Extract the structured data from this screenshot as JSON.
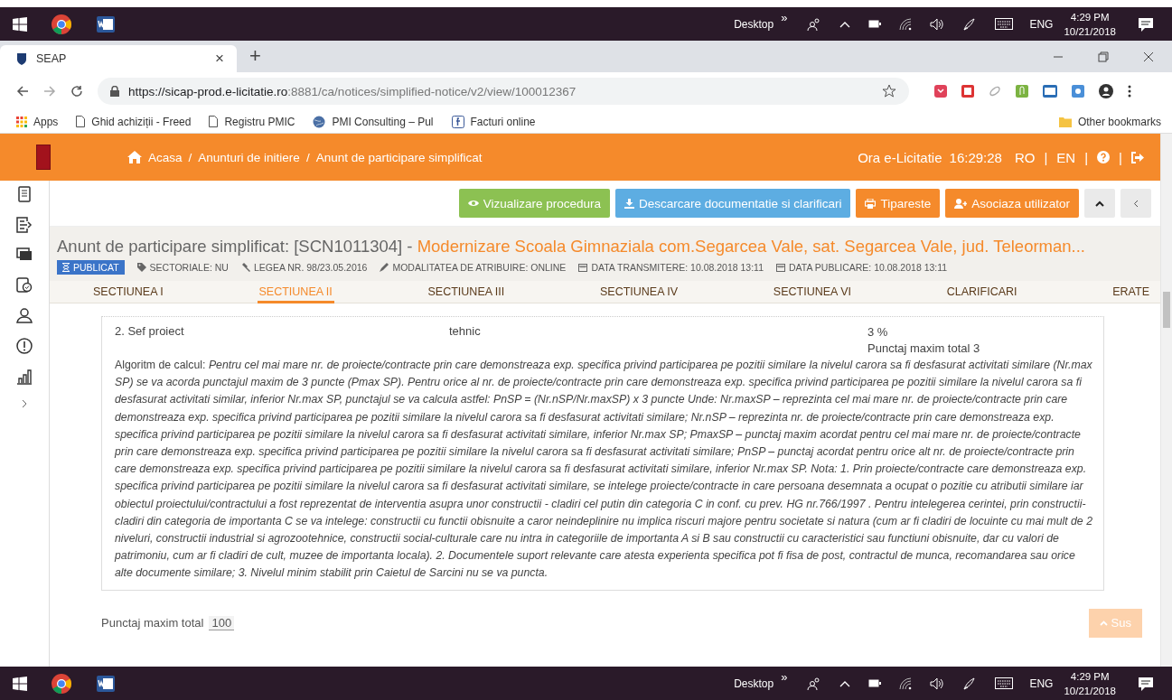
{
  "taskbars": [
    {
      "desktop_label": "Desktop",
      "overflow": "»",
      "language": "ENG",
      "time": "4:29 PM",
      "date": "10/21/2018"
    },
    {
      "desktop_label": "Desktop",
      "overflow": "»",
      "language": "ENG",
      "time": "4:29 PM",
      "date": "10/21/2018"
    }
  ],
  "browser": {
    "tab": {
      "title": "SEAP",
      "close": "×"
    },
    "new_tab": "+",
    "url_host": "https://sicap-prod.e-licitatie.ro",
    "url_path": ":8881/ca/notices/simplified-notice/v2/view/100012367",
    "bookmarks": [
      {
        "label": "Apps",
        "kind": "apps"
      },
      {
        "label": "Ghid achiziții - Freed",
        "kind": "page"
      },
      {
        "label": "Registru PMIC",
        "kind": "page"
      },
      {
        "label": "PMI Consulting – Pul",
        "kind": "globe"
      },
      {
        "label": "Facturi online",
        "kind": "f"
      }
    ],
    "other_bookmarks": "Other bookmarks"
  },
  "header": {
    "breadcrumbs": [
      "Acasa",
      "Anunturi de initiere",
      "Anunt de participare simplificat"
    ],
    "breadcrumb_separator": "/",
    "clock_label": "Ora e-Licitatie",
    "clock": "16:29:28",
    "languages": [
      "RO",
      "EN"
    ],
    "separator": "|"
  },
  "toolbar": [
    {
      "label": "Vizualizare procedura",
      "kind": "view"
    },
    {
      "label": "Descarcare documentatie si clarificari",
      "kind": "download"
    },
    {
      "label": "Tipareste",
      "kind": "print"
    },
    {
      "label": "Asociaza utilizator",
      "kind": "user"
    }
  ],
  "notice": {
    "title_prefix": "Anunt de participare simplificat: [SCN1011304] - ",
    "title_name": "Modernizare Scoala Gimnaziala com.Segarcea Vale, sat. Segarcea Vale, jud. Teleorman...",
    "status": "PUBLICAT",
    "tags": [
      {
        "label": "SECTORIALE: NU",
        "kind": "tag"
      },
      {
        "label": "LEGEA NR. 98/23.05.2016",
        "kind": "gavel"
      },
      {
        "label": "MODALITATEA DE ATRIBUIRE: ONLINE",
        "kind": "pen"
      },
      {
        "label": "DATA TRANSMITERE: 10.08.2018 13:11",
        "kind": "calendar"
      },
      {
        "label": "DATA PUBLICARE: 10.08.2018 13:11",
        "kind": "calendar"
      }
    ]
  },
  "sections": [
    {
      "label": "SECTIUNEA I",
      "selected": false
    },
    {
      "label": "SECTIUNEA II",
      "selected": true
    },
    {
      "label": "SECTIUNEA III",
      "selected": false
    },
    {
      "label": "SECTIUNEA IV",
      "selected": false
    },
    {
      "label": "SECTIUNEA VI",
      "selected": false
    },
    {
      "label": "CLARIFICARI",
      "selected": false
    },
    {
      "label": "ERATE",
      "selected": false
    }
  ],
  "criterion": {
    "name": "2. Sef proiect",
    "type": "tehnic",
    "weight": "3 %",
    "max_score": "Punctaj maxim total 3",
    "algorithm": "Algoritm de calcul: *Pentru cel mai mare nr. de proiecte/contracte prin care demonstreaza exp. specifica privind participarea pe pozitii similare la nivelul carora sa fi desfasurat activitati similare (Nr.max SP) se va acorda punctajul maxim de 3 puncte (Pmax SP). Pentru orice al nr. de proiecte/contracte prin care demonstreaza exp. specifica privind participarea pe pozitii similare la nivelul carora sa fi desfasurat activitati similar, inferior Nr.max SP, punctajul se va calcula astfel: PnSP = (Nr.nSP/Nr.maxSP) x 3 puncte Unde: Nr.maxSP – reprezinta cel mai mare nr. de proiecte/contracte prin care demonstreaza exp. specifica privind participarea pe pozitii similare la nivelul carora sa fi desfasurat activitati similare; Nr.nSP – reprezinta nr. de proiecte/contracte prin care demonstreaza exp. specifica privind participarea pe pozitii similare la nivelul carora sa fi desfasurat activitati similare, inferior Nr.max SP; PmaxSP – punctaj maxim acordat pentru cel mai mare nr. de proiecte/contracte prin care demonstreaza exp. specifica privind participarea pe pozitii similare la nivelul carora sa fi desfasurat activitati similare; PnSP – punctaj acordat pentru orice alt nr. de proiecte/contracte prin care demonstreaza exp. specifica privind participarea pe pozitii similare la nivelul carora sa fi desfasurat activitati similare, inferior Nr.max SP. Nota: 1. Prin proiecte/contracte care demonstreaza exp. specifica privind participarea pe pozitii similare la nivelul carora sa fi desfasurat activitati similare, se intelege proiecte/contracte in care persoana desemnata a ocupat o pozitie cu atributii similare iar obiectul proiectului/contractului a fost reprezentat de interventia asupra unor constructii - cladiri cel putin din categoria C in conf. cu prev. HG nr.766/1997 . Pentru intelegerea cerintei, prin constructii-cladiri din categoria de importanta C se va intelege: constructii cu functii obisnuite a caror neindeplinire nu implica riscuri majore pentru societate si natura (cum ar fi cladiri de locuinte cu mai mult de 2 niveluri, constructii industrial si agrozootehnice, constructii social-culturale care nu intra in categoriile de importanta A si B sau constructii cu caracteristici sau functiuni obisnuite, dar cu valori de patrimoniu, cum ar fi cladiri de cult, muzee de importanta locala). 2. Documentele suport relevante care atesta experienta specifica pot fi fisa de post, contractul de munca, recomandarea sau orice alte documente similare; 3. Nivelul minim stabilit prin Caietul de Sarcini nu se va puncta.*"
  },
  "total": {
    "label": "Punctaj maxim total",
    "value": "100"
  },
  "scroll_top": "Sus"
}
